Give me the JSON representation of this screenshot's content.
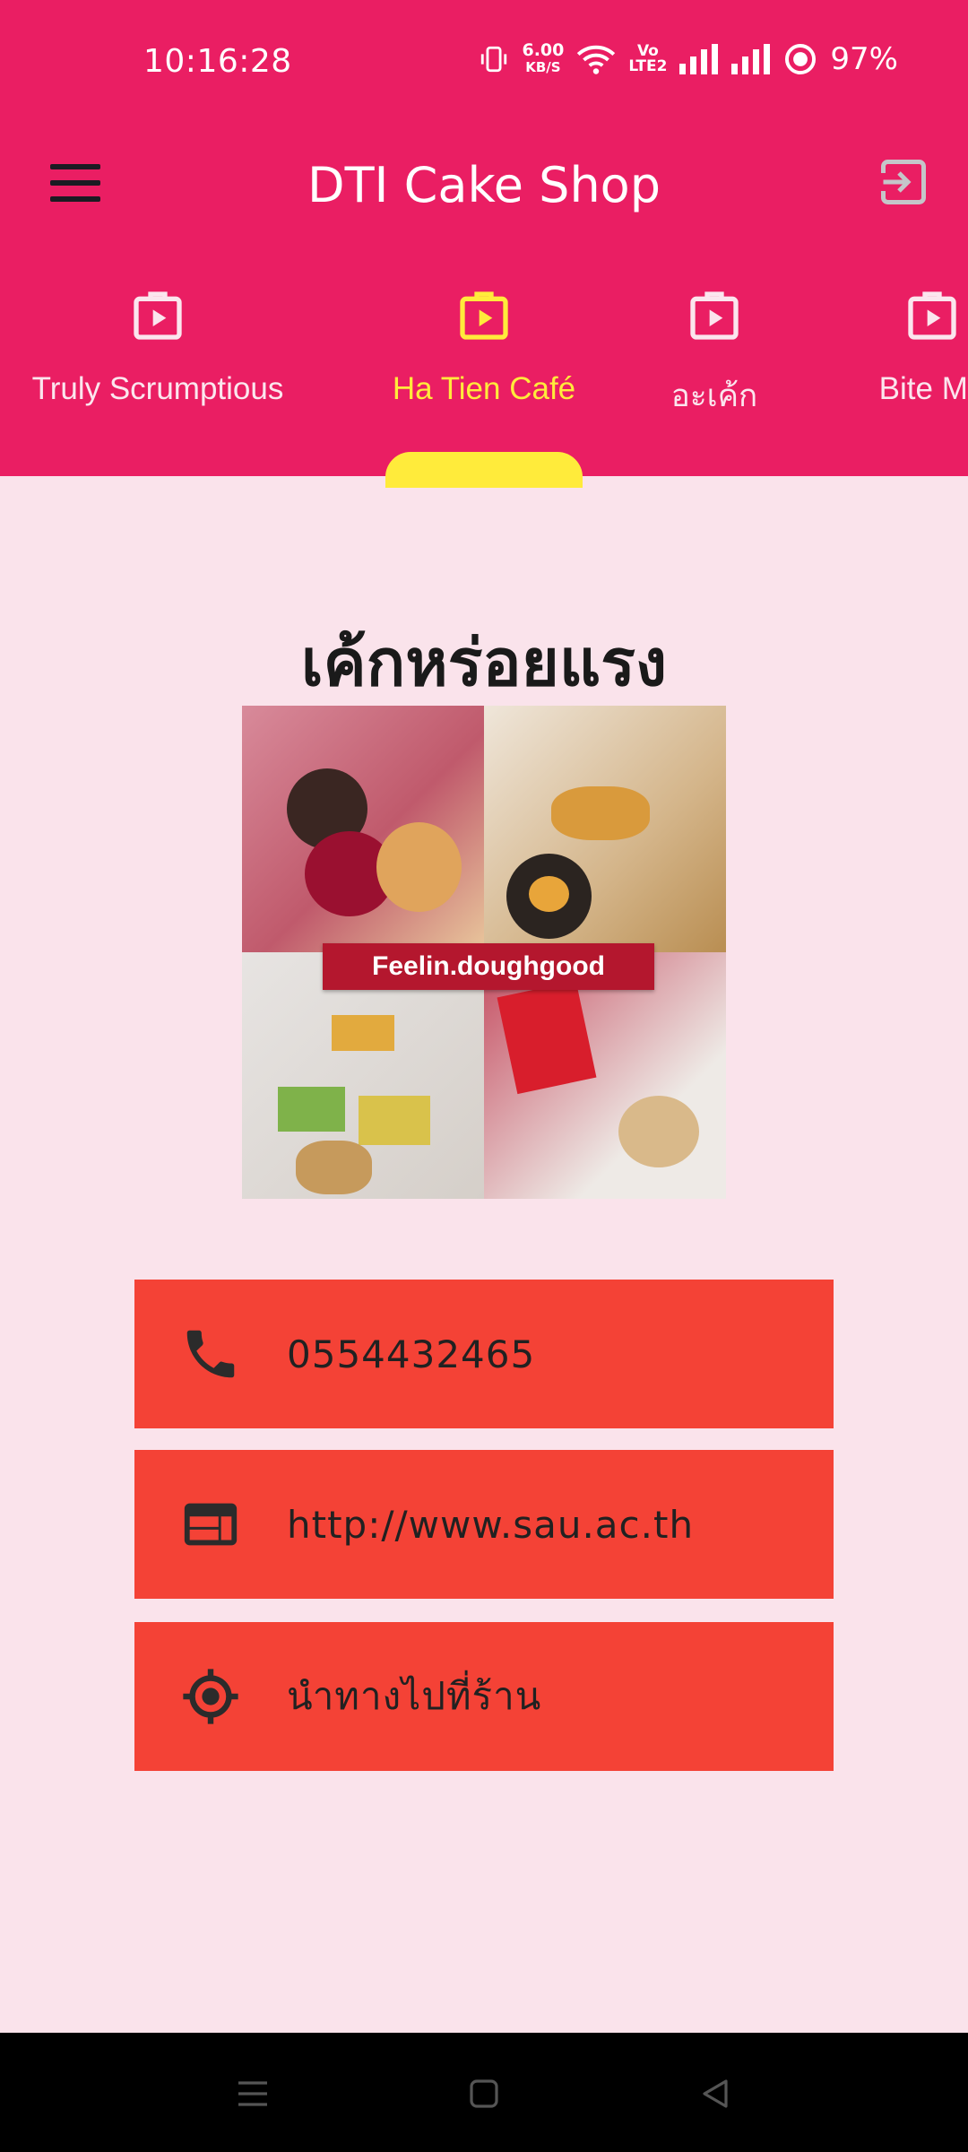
{
  "status_bar": {
    "time": "10:16:28",
    "network_speed": "6.00",
    "network_speed_unit": "KB/S",
    "volte_top": "Vo",
    "volte_bottom": "LTE2",
    "battery": "97%"
  },
  "toolbar": {
    "title": "DTI Cake Shop",
    "menu_icon": "hamburger-menu-icon",
    "logout_icon": "logout-icon"
  },
  "tabs": [
    {
      "label": "Truly Scrumptious",
      "icon": "store-icon",
      "active": false
    },
    {
      "label": "Ha Tien Café",
      "icon": "store-icon",
      "active": true
    },
    {
      "label": "อะเค้ก",
      "icon": "store-icon",
      "active": false
    },
    {
      "label": "Bite Me",
      "icon": "store-icon",
      "active": false
    }
  ],
  "shop": {
    "heading": "เค้กหร่อยแรง",
    "image_banner": "Feelin.doughgood",
    "phone": "0554432465",
    "website": "http://www.sau.ac.th",
    "directions": "นำทางไปที่ร้าน"
  },
  "colors": {
    "primary": "#ea1e63",
    "accent": "#ffeb3b",
    "button": "#f44236",
    "background": "#fae3eb"
  }
}
